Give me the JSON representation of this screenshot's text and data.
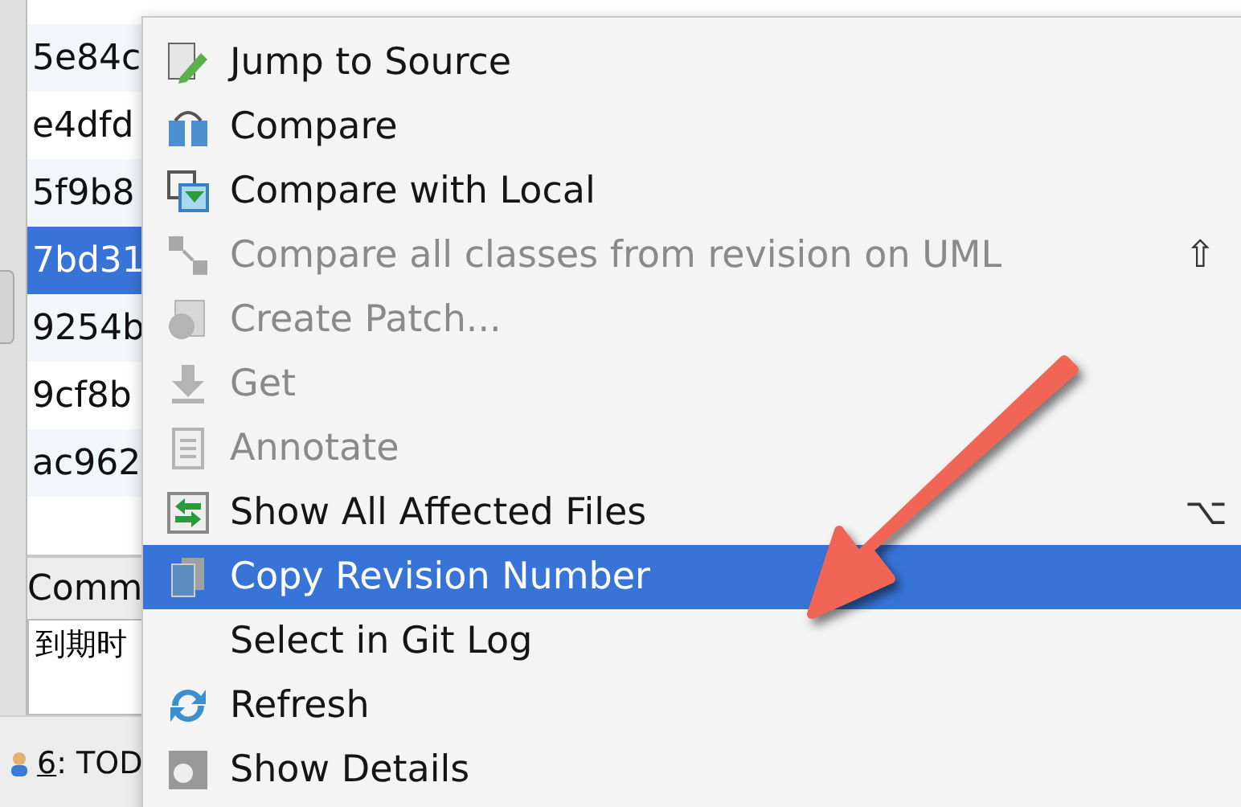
{
  "commits": [
    {
      "hash": "5e84c",
      "selected": false
    },
    {
      "hash": "e4dfd",
      "selected": false
    },
    {
      "hash": "5f9b8",
      "selected": false
    },
    {
      "hash": "7bd31",
      "selected": true
    },
    {
      "hash": "9254b",
      "selected": false
    },
    {
      "hash": "9cf8b",
      "selected": false
    },
    {
      "hash": "ac962",
      "selected": false
    }
  ],
  "commit_message": {
    "label": "Comm",
    "value": "到期时"
  },
  "tool_windows": [
    {
      "mnemonic": "6",
      "label": ": TOD",
      "kind": "todo"
    }
  ],
  "context_menu": {
    "items": [
      {
        "label": "Jump to Source",
        "kind": "edit",
        "disabled": false,
        "selected": false
      },
      {
        "label": "Compare",
        "kind": "compare",
        "disabled": false,
        "selected": false
      },
      {
        "label": "Compare with Local",
        "kind": "local",
        "disabled": false,
        "selected": false
      },
      {
        "label": "Compare all classes from revision on UML",
        "kind": "diagram",
        "disabled": true,
        "selected": false,
        "shortcut": "⇧"
      },
      {
        "label": "Create Patch...",
        "kind": "patch",
        "disabled": true,
        "selected": false
      },
      {
        "label": "Get",
        "kind": "get",
        "disabled": true,
        "selected": false
      },
      {
        "label": "Annotate",
        "kind": "annotate",
        "disabled": true,
        "selected": false
      },
      {
        "label": "Show All Affected Files",
        "kind": "affected",
        "disabled": false,
        "selected": false,
        "shortcut": "⌥"
      },
      {
        "label": "Copy Revision Number",
        "kind": "copy",
        "disabled": false,
        "selected": true
      },
      {
        "label": "Select in Git Log",
        "kind": "none",
        "disabled": false,
        "selected": false
      },
      {
        "label": "Refresh",
        "kind": "refresh",
        "disabled": false,
        "selected": false
      },
      {
        "label": "Show Details",
        "kind": "details",
        "disabled": false,
        "selected": false
      }
    ]
  }
}
